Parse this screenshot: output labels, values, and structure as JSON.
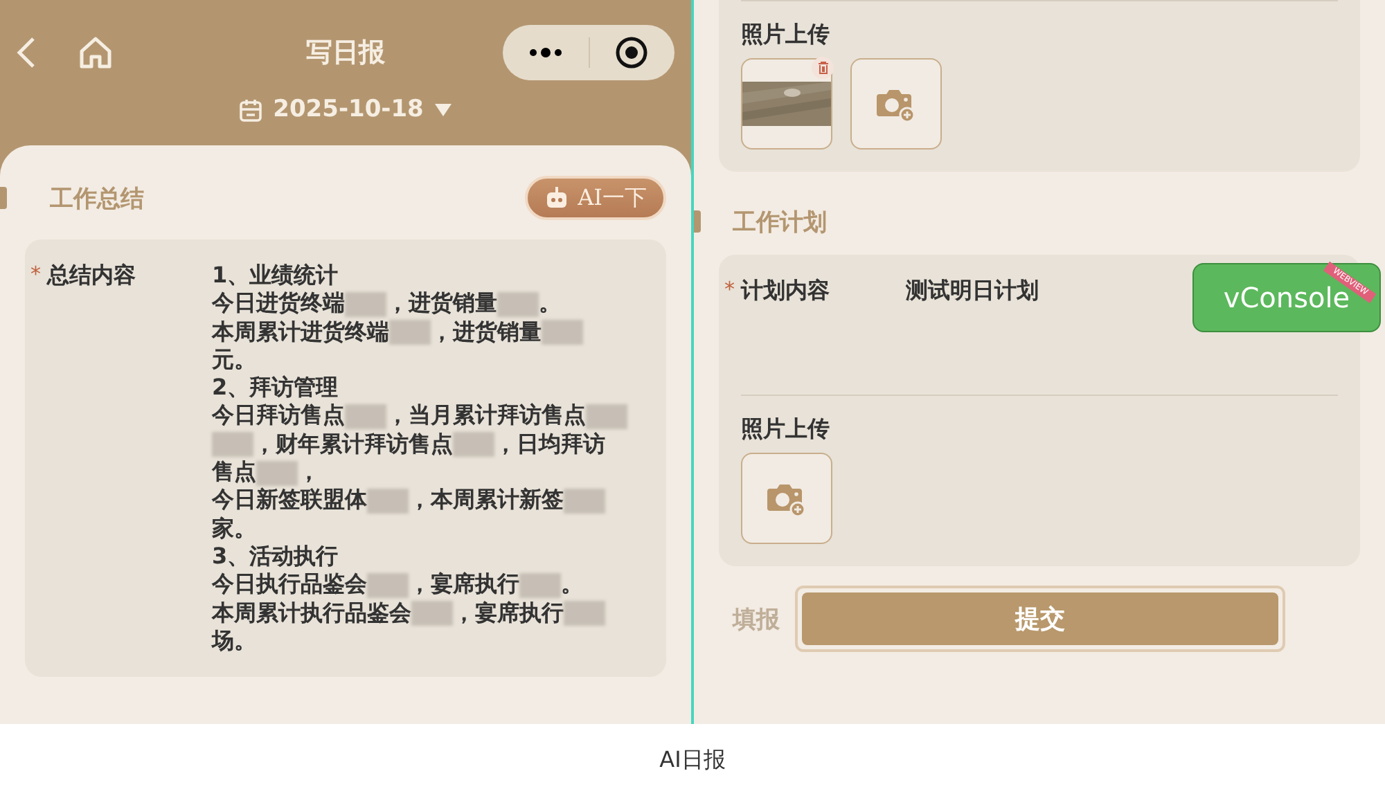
{
  "left_screen": {
    "nav": {
      "title": "写日报"
    },
    "date": "2025-10-18",
    "section": {
      "title": "工作总结",
      "ai_button": "AI一下"
    },
    "summary": {
      "label": "总结内容",
      "required_mark": "*",
      "lines": [
        [
          {
            "kind": "text",
            "text": "1、业绩统计"
          }
        ],
        [
          {
            "kind": "text",
            "text": "今日进货终端"
          },
          {
            "kind": "redacted"
          },
          {
            "kind": "text",
            "text": "，进货销量"
          },
          {
            "kind": "redacted"
          },
          {
            "kind": "text",
            "text": "。"
          }
        ],
        [
          {
            "kind": "text",
            "text": "本周累计进货终端"
          },
          {
            "kind": "redacted"
          },
          {
            "kind": "text",
            "text": "，进货销量"
          },
          {
            "kind": "redacted"
          }
        ],
        [
          {
            "kind": "text",
            "text": "元。"
          }
        ],
        [
          {
            "kind": "text",
            "text": "2、拜访管理"
          }
        ],
        [
          {
            "kind": "text",
            "text": "今日拜访售点"
          },
          {
            "kind": "redacted"
          },
          {
            "kind": "text",
            "text": "，当月累计拜访售点"
          },
          {
            "kind": "redacted"
          }
        ],
        [
          {
            "kind": "redacted"
          },
          {
            "kind": "text",
            "text": "，财年累计拜访售点"
          },
          {
            "kind": "redacted"
          },
          {
            "kind": "text",
            "text": "，日均拜访"
          }
        ],
        [
          {
            "kind": "text",
            "text": "售点"
          },
          {
            "kind": "redacted"
          },
          {
            "kind": "text",
            "text": "，"
          }
        ],
        [
          {
            "kind": "text",
            "text": "今日新签联盟体"
          },
          {
            "kind": "redacted"
          },
          {
            "kind": "text",
            "text": "，本周累计新签"
          },
          {
            "kind": "redacted"
          }
        ],
        [
          {
            "kind": "text",
            "text": "家。"
          }
        ],
        [
          {
            "kind": "text",
            "text": "3、活动执行"
          }
        ],
        [
          {
            "kind": "text",
            "text": "今日执行品鉴会"
          },
          {
            "kind": "redacted"
          },
          {
            "kind": "text",
            "text": "，宴席执行"
          },
          {
            "kind": "redacted"
          },
          {
            "kind": "text",
            "text": "。"
          }
        ],
        [
          {
            "kind": "text",
            "text": "本周累计执行品鉴会"
          },
          {
            "kind": "redacted"
          },
          {
            "kind": "text",
            "text": "，宴席执行"
          },
          {
            "kind": "redacted"
          }
        ],
        [
          {
            "kind": "text",
            "text": "场。"
          }
        ]
      ]
    }
  },
  "right_screen": {
    "summary_photos": {
      "label": "照片上传",
      "items": [
        {
          "kind": "picture"
        },
        {
          "kind": "add"
        }
      ]
    },
    "section": {
      "title": "工作计划"
    },
    "plan": {
      "label": "计划内容",
      "required_mark": "*",
      "value": "测试明日计划"
    },
    "plan_photos": {
      "label": "照片上传",
      "items": [
        {
          "kind": "add"
        }
      ]
    },
    "next_section": {
      "title": "填报"
    },
    "submit": "提交",
    "vconsole": {
      "label": "vConsole",
      "ribbon": "WEBVIEW"
    }
  },
  "caption": "AI日报"
}
